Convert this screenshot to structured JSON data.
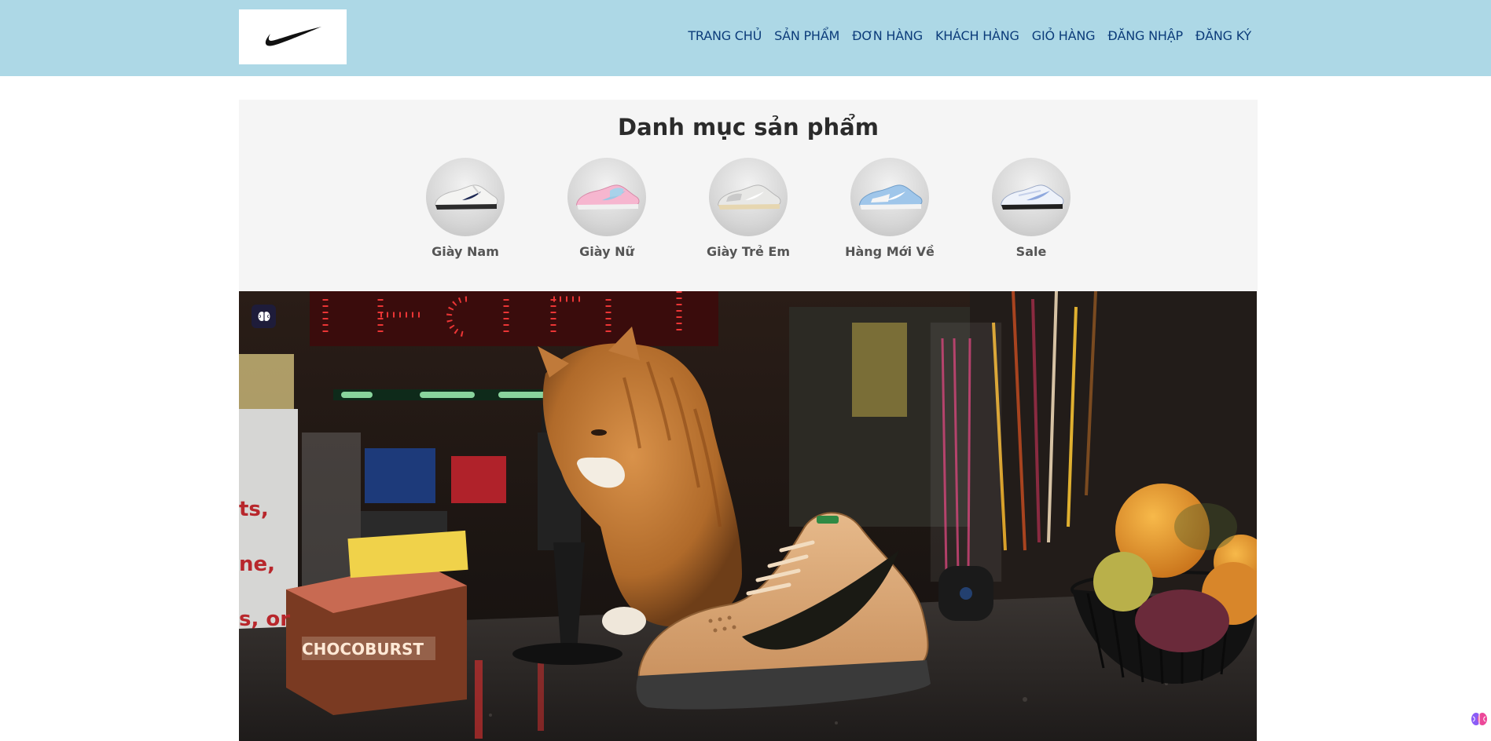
{
  "header": {
    "logo": "nike-swoosh-logo",
    "nav": [
      {
        "label": "TRANG CHỦ"
      },
      {
        "label": "SẢN PHẨM"
      },
      {
        "label": "ĐƠN HÀNG"
      },
      {
        "label": "KHÁCH HÀNG"
      },
      {
        "label": "GIỎ HÀNG"
      },
      {
        "label": "ĐĂNG NHẬP"
      },
      {
        "label": "ĐĂNG KÝ"
      }
    ]
  },
  "categories": {
    "title": "Danh mục sản phẩm",
    "items": [
      {
        "label": "Giày Nam",
        "icon": "white-sneaker-navy-swoosh"
      },
      {
        "label": "Giày Nữ",
        "icon": "pink-blue-sneaker"
      },
      {
        "label": "Giày Trẻ Em",
        "icon": "grey-cream-sneaker"
      },
      {
        "label": "Hàng Mới Về",
        "icon": "light-blue-sneaker"
      },
      {
        "label": "Sale",
        "icon": "white-blue-sneaker"
      }
    ]
  },
  "banner": {
    "image": "cat-sniffing-tan-sneaker-shop-counter-photo",
    "badge_icon": "brain-icon",
    "product_box_text": "CHOCOBURST"
  },
  "extension_icon": "brain-extension-icon",
  "colors": {
    "header_bg": "#add8e6",
    "nav_text": "#0c3c7a",
    "panel_bg": "#f5f5f5"
  }
}
